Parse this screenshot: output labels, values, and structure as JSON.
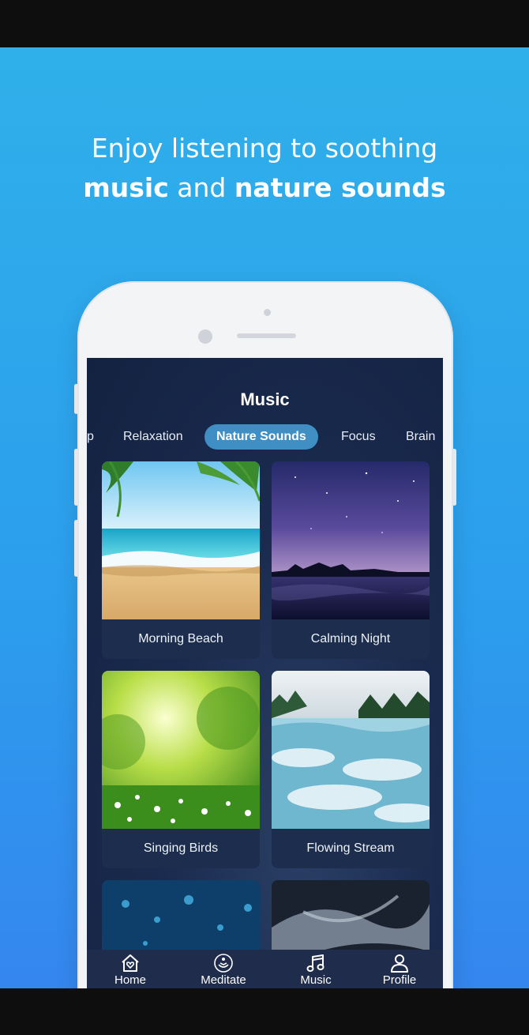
{
  "headline": {
    "line1": "Enjoy listening to soothing",
    "line2_bold1": "music",
    "line2_mid": " and ",
    "line2_bold2": "nature sounds"
  },
  "screen": {
    "title": "Music",
    "tabs": [
      {
        "label": "p",
        "active": false
      },
      {
        "label": "Relaxation",
        "active": false
      },
      {
        "label": "Nature Sounds",
        "active": true
      },
      {
        "label": "Focus",
        "active": false
      },
      {
        "label": "Brain",
        "active": false
      }
    ],
    "cards": [
      {
        "label": "Morning Beach",
        "image": "beach-image"
      },
      {
        "label": "Calming Night",
        "image": "night-lake-image"
      },
      {
        "label": "Singing Birds",
        "image": "meadow-image"
      },
      {
        "label": "Flowing Stream",
        "image": "river-image"
      },
      {
        "label": "",
        "image": "raindrops-image"
      },
      {
        "label": "",
        "image": "clouds-image"
      }
    ],
    "nav": [
      {
        "label": "Home",
        "icon": "home-heart-icon"
      },
      {
        "label": "Meditate",
        "icon": "meditate-icon"
      },
      {
        "label": "Music",
        "icon": "music-note-icon"
      },
      {
        "label": "Profile",
        "icon": "profile-icon"
      }
    ]
  },
  "colors": {
    "promo_bg": "#2fb0ea",
    "screen_bg": "#17284a",
    "active_tab": "#3f8fc4",
    "nav_bg": "#1f2c4c"
  }
}
